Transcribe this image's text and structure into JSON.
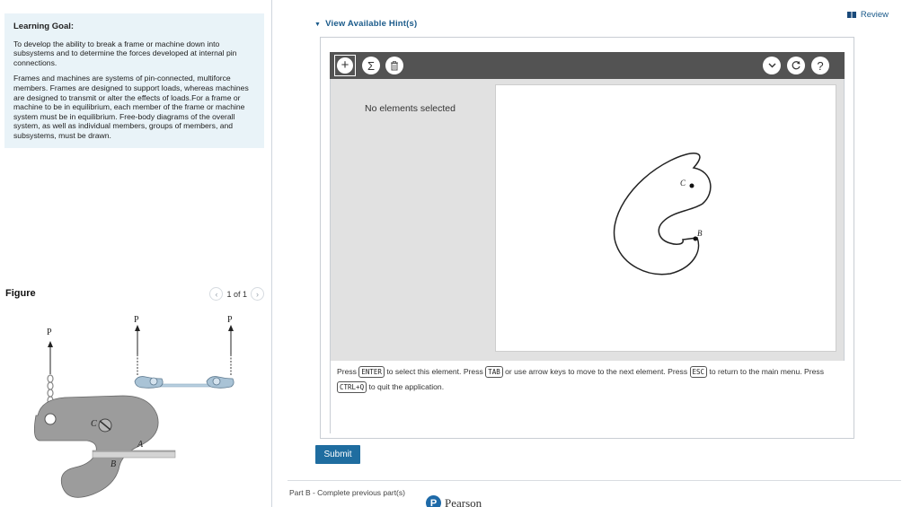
{
  "learning_goal": {
    "heading": "Learning Goal:",
    "para1": "To develop the ability to break a frame or machine down into subsystems and to determine the forces developed at internal pin connections.",
    "para2": "Frames and machines are systems of pin-connected, multiforce members. Frames are designed to support loads, whereas machines are designed to transmit or alter the effects of loads.For a frame or machine to be in equilibrium, each member of the frame or machine system must be in equilibrium. Free-body diagrams of the overall system, as well as individual members, groups of members, and subsystems, must be drawn."
  },
  "figure": {
    "title": "Figure",
    "pager_text": "1 of 1",
    "prev_icon": "chevron-left-icon",
    "next_icon": "chevron-right-icon",
    "labels": {
      "p1": "P",
      "p2": "P",
      "p3": "P",
      "c": "C",
      "a": "A",
      "b": "B"
    }
  },
  "header": {
    "hints_label": "View Available Hint(s)",
    "review_label": "Review"
  },
  "toolbar": {
    "add_icon": "plus-icon",
    "sum_icon": "sigma-icon",
    "delete_icon": "trash-icon",
    "dropdown_icon": "chevron-down-icon",
    "reset_icon": "reset-icon",
    "help_icon": "question-icon"
  },
  "workspace": {
    "no_selection": "No elements selected",
    "drawing_labels": {
      "c": "C",
      "b": "B"
    },
    "instructions": {
      "t1": "Press",
      "k1": "ENTER",
      "t2": "to select this element. Press",
      "k2": "TAB",
      "t3": "or use arrow keys to move to the next element. Press",
      "k3": "ESC",
      "t4": "to return to the main menu. Press",
      "k4": "CTRL+Q",
      "t5": "to quit the application."
    }
  },
  "footer": {
    "submit_label": "Submit",
    "part_b_label": "Part B - Complete previous part(s)",
    "brand": "Pearson"
  },
  "colors": {
    "accent": "#1f6da0",
    "link": "#1a5a8a",
    "toolbar": "#535353",
    "goal_bg": "#e9f3f8"
  }
}
